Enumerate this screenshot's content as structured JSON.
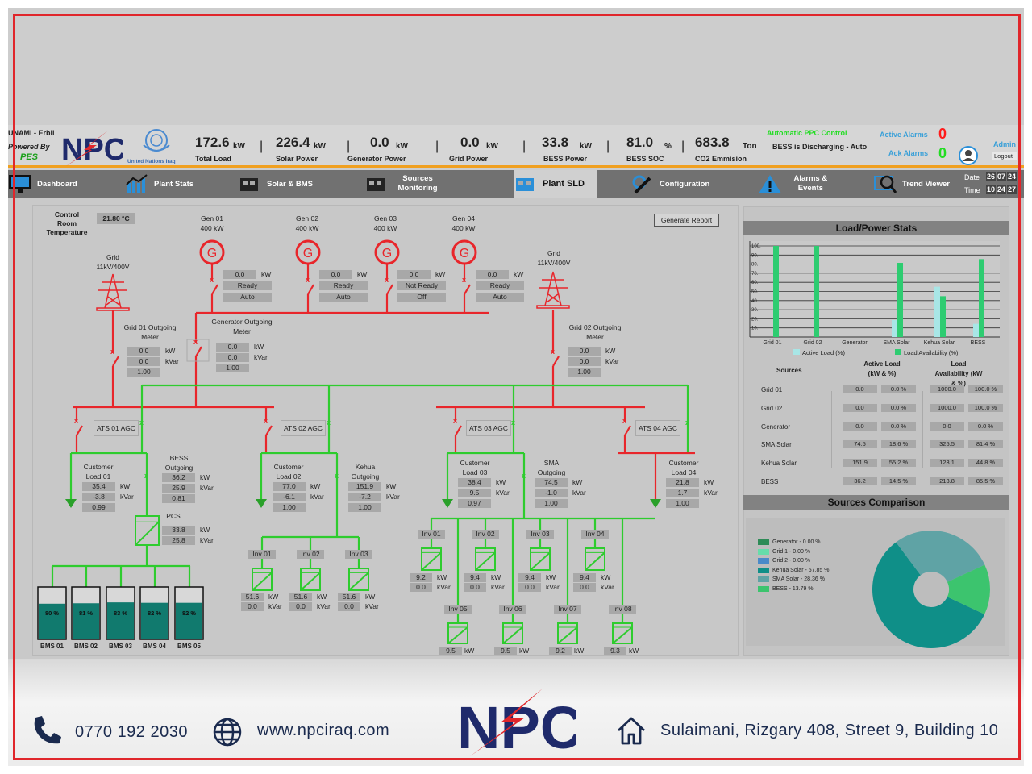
{
  "header": {
    "site": "UNAMI - Erbil",
    "powered_by": "Powered By",
    "pes": "PES",
    "logo": "NPC",
    "un_logo": "United Nations Iraq",
    "kpis": [
      {
        "value": "172.6",
        "unit": "kW",
        "label": "Total Load"
      },
      {
        "value": "226.4",
        "unit": "kW",
        "label": "Solar Power"
      },
      {
        "value": "0.0",
        "unit": "kW",
        "label": "Generator Power"
      },
      {
        "value": "0.0",
        "unit": "kW",
        "label": "Grid Power"
      },
      {
        "value": "33.8",
        "unit": "kW",
        "label": "BESS Power"
      },
      {
        "value": "81.0",
        "unit": "%",
        "label": "BESS SOC"
      },
      {
        "value": "683.8",
        "unit": "Ton",
        "label": "CO2 Emmision"
      }
    ],
    "ppc_mode": "Automatic PPC Control",
    "bess_status": "BESS is Discharging - Auto",
    "active_alarms_label": "Active Alarms",
    "active_alarms": "0",
    "ack_alarms_label": "Ack Alarms",
    "ack_alarms": "0",
    "user": "Admin",
    "logout": "Logout"
  },
  "nav": {
    "items": [
      {
        "label": "Dashboard",
        "icon": "monitor-chart-icon"
      },
      {
        "label": "Plant Stats",
        "icon": "bar-chart-icon"
      },
      {
        "label": "Solar & BMS",
        "icon": "solar-battery-icon"
      },
      {
        "label": "Sources Monitoring",
        "icon": "generator-icon"
      },
      {
        "label": "Plant SLD",
        "icon": "solar-panel-icon",
        "active": true
      },
      {
        "label": "Configuration",
        "icon": "gear-wrench-icon"
      },
      {
        "label": "Alarms & Events",
        "icon": "warning-icon"
      },
      {
        "label": "Trend Viewer",
        "icon": "trend-search-icon"
      }
    ],
    "date_label": "Date",
    "date": [
      "26",
      "07",
      "24"
    ],
    "time_label": "Time",
    "time": [
      "10",
      "24",
      "27"
    ]
  },
  "sld": {
    "temp_label": "Control Room Temperature",
    "temp": "21.80 °C",
    "generate_report": "Generate Report",
    "grid1": {
      "name": "Grid",
      "rating": "11kV/400V"
    },
    "grid2": {
      "name": "Grid",
      "rating": "11kV/400V"
    },
    "gens": [
      {
        "name": "Gen 01",
        "rating": "400 kW",
        "kw": "0.0",
        "status": "Ready",
        "mode": "Auto"
      },
      {
        "name": "Gen 02",
        "rating": "400 kW",
        "kw": "0.0",
        "status": "Ready",
        "mode": "Auto"
      },
      {
        "name": "Gen 03",
        "rating": "400 kW",
        "kw": "0.0",
        "status": "Not Ready",
        "mode": "Off"
      },
      {
        "name": "Gen 04",
        "rating": "400 kW",
        "kw": "0.0",
        "status": "Ready",
        "mode": "Auto"
      }
    ],
    "meters": {
      "grid1_out": {
        "label": "Grid 01 Outgoing Meter",
        "kw": "0.0",
        "kvar": "0.0",
        "pf": "1.00"
      },
      "gen_out": {
        "label": "Generator Outgoing Meter",
        "kw": "0.0",
        "kvar": "0.0",
        "pf": "1.00"
      },
      "grid2_out": {
        "label": "Grid 02 Outgoing Meter",
        "kw": "0.0",
        "kvar": "0.0",
        "pf": "1.00"
      },
      "load1": {
        "label": "Customer Load 01",
        "kw": "35.4",
        "kvar": "-3.8",
        "pf": "0.99"
      },
      "bess_out": {
        "label": "BESS Outgoing",
        "kw": "36.2",
        "kvar": "25.9",
        "pf": "0.81"
      },
      "load2": {
        "label": "Customer Load 02",
        "kw": "77.0",
        "kvar": "-6.1",
        "pf": "1.00"
      },
      "kehua_out": {
        "label": "Kehua Outgoing",
        "kw": "151.9",
        "kvar": "-7.2",
        "pf": "1.00"
      },
      "load3": {
        "label": "Customer Load 03",
        "kw": "38.4",
        "kvar": "9.5",
        "pf": "0.97"
      },
      "sma_out": {
        "label": "SMA Outgoing",
        "kw": "74.5",
        "kvar": "-1.0",
        "pf": "1.00"
      },
      "load4": {
        "label": "Customer Load 04",
        "kw": "21.8",
        "kvar": "1.7",
        "pf": "1.00"
      }
    },
    "pcs": {
      "label": "PCS",
      "kw": "33.8",
      "kvar": "25.8"
    },
    "ats": [
      "ATS 01 AGC",
      "ATS 02 AGC",
      "ATS 03 AGC",
      "ATS 04 AGC"
    ],
    "bms": [
      {
        "name": "BMS 01",
        "soc": 80,
        "soc_text": "80 %"
      },
      {
        "name": "BMS 02",
        "soc": 81,
        "soc_text": "81 %"
      },
      {
        "name": "BMS 03",
        "soc": 83,
        "soc_text": "83 %"
      },
      {
        "name": "BMS 04",
        "soc": 82,
        "soc_text": "82 %"
      },
      {
        "name": "BMS 05",
        "soc": 82,
        "soc_text": "82 %"
      }
    ],
    "kehua_inverters": [
      {
        "name": "Inv 01",
        "kw": "51.6",
        "kvar": "0.0"
      },
      {
        "name": "Inv 02",
        "kw": "51.6",
        "kvar": "0.0"
      },
      {
        "name": "Inv 03",
        "kw": "51.6",
        "kvar": "0.0"
      }
    ],
    "sma_inverters": [
      {
        "name": "Inv 01",
        "kw": "9.2",
        "kvar": "0.0"
      },
      {
        "name": "Inv 02",
        "kw": "9.4",
        "kvar": "0.0"
      },
      {
        "name": "Inv 03",
        "kw": "9.4",
        "kvar": "0.0"
      },
      {
        "name": "Inv 04",
        "kw": "9.4",
        "kvar": "0.0"
      },
      {
        "name": "Inv 05",
        "kw": "9.5"
      },
      {
        "name": "Inv 06",
        "kw": "9.5"
      },
      {
        "name": "Inv 07",
        "kw": "9.2"
      },
      {
        "name": "Inv 08",
        "kw": "9.3"
      }
    ],
    "units": {
      "kw": "kW",
      "kvar": "kVar"
    },
    "colors": {
      "dead": "#e8262b",
      "live": "#2ecc2e",
      "battery": "#117a6e"
    }
  },
  "stats": {
    "title": "Load/Power Stats",
    "sources_header": "Sources",
    "active_header": "Active Load (kW & %)",
    "avail_header": "Load Availability (kW & %)",
    "rows": [
      {
        "source": "Grid 01",
        "active_kw": "0.0",
        "active_pct": "0.0 %",
        "avail_kw": "1000.0",
        "avail_pct": "100.0 %"
      },
      {
        "source": "Grid 02",
        "active_kw": "0.0",
        "active_pct": "0.0 %",
        "avail_kw": "1000.0",
        "avail_pct": "100.0 %"
      },
      {
        "source": "Generator",
        "active_kw": "0.0",
        "active_pct": "0.0 %",
        "avail_kw": "0.0",
        "avail_pct": "0.0 %"
      },
      {
        "source": "SMA Solar",
        "active_kw": "74.5",
        "active_pct": "18.6 %",
        "avail_kw": "325.5",
        "avail_pct": "81.4 %"
      },
      {
        "source": "Kehua Solar",
        "active_kw": "151.9",
        "active_pct": "55.2 %",
        "avail_kw": "123.1",
        "avail_pct": "44.8 %"
      },
      {
        "source": "BESS",
        "active_kw": "36.2",
        "active_pct": "14.5 %",
        "avail_kw": "213.8",
        "avail_pct": "85.5 %"
      }
    ]
  },
  "comparison": {
    "title": "Sources Comparison"
  },
  "chart_data": [
    {
      "type": "bar",
      "categories": [
        "Grid 01",
        "Grid 02",
        "Generator",
        "SMA Solar",
        "Kehua Solar",
        "BESS"
      ],
      "series": [
        {
          "name": "Active Load (%)",
          "values": [
            0,
            0,
            0,
            18.6,
            55.2,
            14.5
          ],
          "color": "#a8e6e6"
        },
        {
          "name": "Load Availability (%)",
          "values": [
            100,
            100,
            0,
            81.4,
            44.8,
            85.5
          ],
          "color": "#2ecc71"
        }
      ],
      "yticks": [
        "10.",
        "20.",
        "30.",
        "40.",
        "50.",
        "60.",
        "70.",
        "80.",
        "90.",
        "100."
      ],
      "ylim": [
        0,
        105
      ],
      "grid": true,
      "legend": "bottom"
    },
    {
      "type": "pie",
      "donut": true,
      "slices": [
        {
          "label": "Generator - 0.00 %",
          "value": 0,
          "color": "#2e8b57"
        },
        {
          "label": "Grid 1 - 0.00 %",
          "value": 0,
          "color": "#66ddaa"
        },
        {
          "label": "Grid 2 - 0.00 %",
          "value": 0,
          "color": "#4a8ac9"
        },
        {
          "label": "Kehua Solar - 57.85 %",
          "value": 57.85,
          "color": "#0f8f88"
        },
        {
          "label": "SMA Solar - 28.36 %",
          "value": 28.36,
          "color": "#5fa3a5"
        },
        {
          "label": "BESS - 13.79 %",
          "value": 13.79,
          "color": "#3cc46e"
        }
      ],
      "legend": "left"
    }
  ],
  "footer": {
    "phone": "0770 192 2030",
    "website": "www.npciraq.com",
    "logo": "NPC",
    "address": "Sulaimani, Rizgary 408, Street 9, Building 10"
  }
}
